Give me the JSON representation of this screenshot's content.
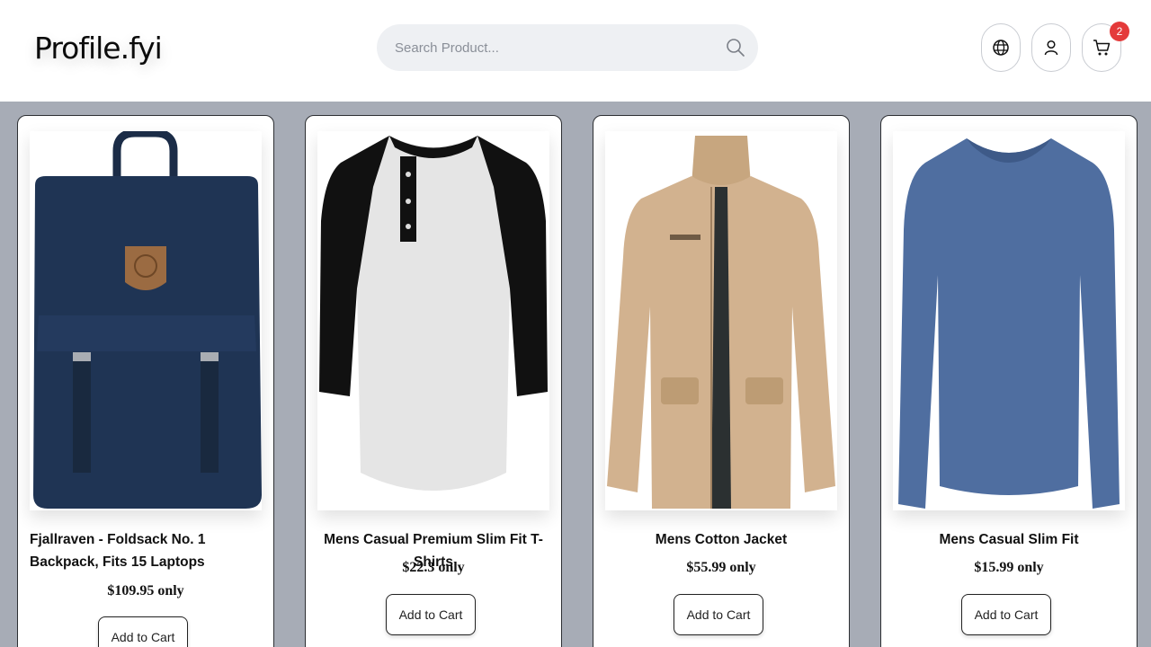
{
  "header": {
    "logo": "Profile.fyi",
    "search_placeholder": "Search Product...",
    "cart_count": "2"
  },
  "products": [
    {
      "title": "Fjallraven - Foldsack No. 1 Backpack, Fits 15 Laptops",
      "price": "$109.95 only",
      "button": "Add to Cart",
      "image": "backpack-image"
    },
    {
      "title": "Mens Casual Premium Slim Fit T-Shirts",
      "price": "$22.3 only",
      "button": "Add to Cart",
      "image": "tshirt-image"
    },
    {
      "title": "Mens Cotton Jacket",
      "price": "$55.99 only",
      "button": "Add to Cart",
      "image": "jacket-image"
    },
    {
      "title": "Mens Casual Slim Fit",
      "price": "$15.99 only",
      "button": "Add to Cart",
      "image": "longsleeve-image"
    }
  ],
  "colors": {
    "background": "#a7acb6",
    "badge": "#e43a3a",
    "backpack": "#1f3454",
    "jacket": "#d2b28f",
    "longsleeve": "#4f6ea0"
  }
}
